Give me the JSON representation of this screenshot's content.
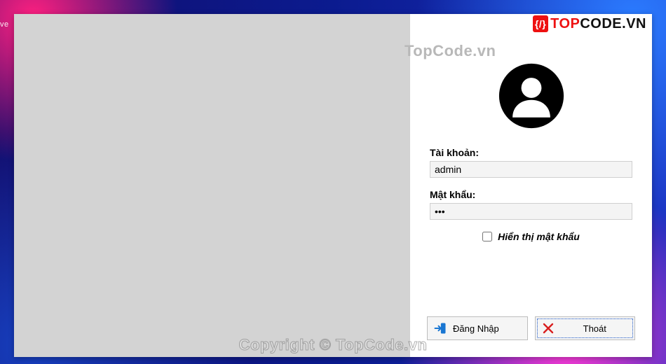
{
  "bg_fragment": "ve",
  "brand": {
    "mark": "{/}",
    "part1": "TOP",
    "part2": "CODE",
    "suffix": ".VN"
  },
  "watermark_top": "TopCode.vn",
  "watermark_bottom": "Copyright © TopCode.vn",
  "form": {
    "account_label": "Tài khoản:",
    "account_value": "admin",
    "password_label": "Mật khẩu:",
    "password_value": "•••",
    "show_password_label": "Hiển thị mật khẩu",
    "show_password_checked": false
  },
  "buttons": {
    "login": "Đăng Nhập",
    "exit": "Thoát"
  }
}
